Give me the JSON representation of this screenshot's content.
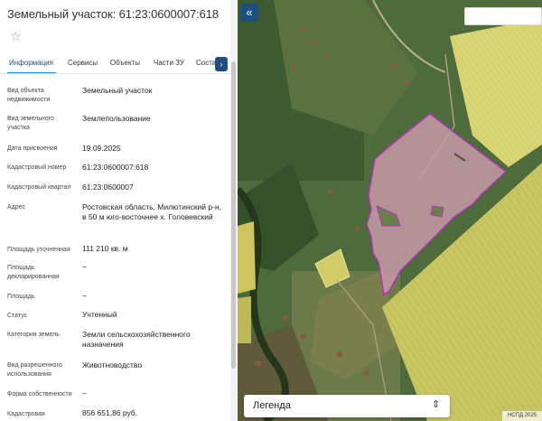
{
  "panel": {
    "title": "Земельный участок: 61:23:0600007:618",
    "star_icon": "☆",
    "tabs": [
      {
        "label": "Информация",
        "active": true
      },
      {
        "label": "Сервисы",
        "active": false
      },
      {
        "label": "Объекты",
        "active": false
      },
      {
        "label": "Части ЗУ",
        "active": false
      },
      {
        "label": "Соста",
        "active": false
      }
    ],
    "tab_next_icon": "›",
    "properties": [
      {
        "label": "Вид объекта недвижимости",
        "value": "Земельный участок"
      },
      {
        "label": "Вид земельного участка",
        "value": "Землепользование"
      },
      {
        "label": "Дата присвоения",
        "value": "19.09.2025"
      },
      {
        "label": "Кадастровый номер",
        "value": "61:23:0600007:618"
      },
      {
        "label": "Кадастровый квартал",
        "value": "61:23:0600007"
      },
      {
        "label": "Адрес",
        "value": "Ростовская область, Милютинский р-н, в 50 м юго-восточнее х. Головевский"
      },
      {
        "label": "Площадь уточненная",
        "value": "111 210 кв. м"
      },
      {
        "label": "Площадь декларированная",
        "value": "–"
      },
      {
        "label": "Площадь",
        "value": "–"
      },
      {
        "label": "Статус",
        "value": "Учтенный"
      },
      {
        "label": "Категория земель",
        "value": "Земли сельскохозяйственного назначения"
      },
      {
        "label": "Вид разрешенного использования",
        "value": "Животноводство"
      },
      {
        "label": "Форма собственности",
        "value": "–"
      },
      {
        "label": "Кадастровая",
        "value": "856 651,86 руб."
      }
    ]
  },
  "map": {
    "collapse_icon": "«",
    "legend_label": "Легенда",
    "legend_icon": "⌃⌄",
    "attribution": "НСПД 2025",
    "colors": {
      "parcel_fill": "#c79aa8",
      "parcel_border": "#b233b8",
      "field_yellow": "#d6d26a",
      "vegetation": "#3f5e30",
      "accent": "#1e4f82"
    }
  }
}
